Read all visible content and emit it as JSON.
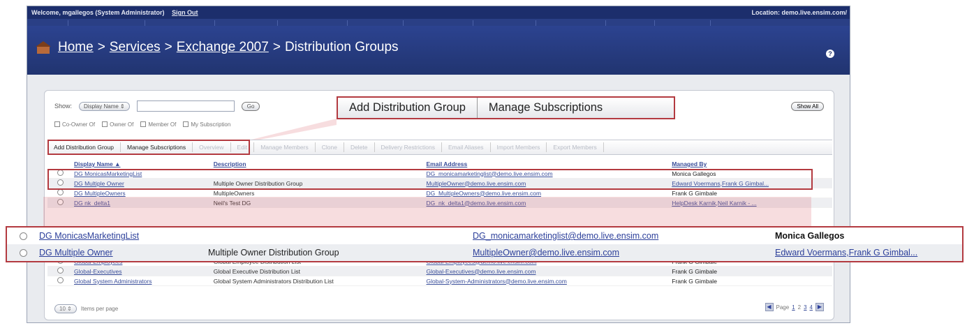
{
  "topbar": {
    "welcome": "Welcome, mgallegos (System Administrator)",
    "signout": "Sign Out",
    "location": "Location: demo.live.ensim.com/"
  },
  "breadcrumb": {
    "home": "Home",
    "services": "Services",
    "exchange": "Exchange 2007",
    "sep": ">",
    "current": "Distribution Groups"
  },
  "filter": {
    "show_label": "Show:",
    "select_value": "Display Name",
    "go_label": "Go",
    "show_all_label": "Show All",
    "checks": [
      "Co-Owner Of",
      "Owner Of",
      "Member Of",
      "My Subscription"
    ]
  },
  "toolbar": {
    "buttons": [
      "Add Distribution Group",
      "Manage Subscriptions",
      "Overview",
      "Edit",
      "Manage Members",
      "Clone",
      "Delete",
      "Delivery Restrictions",
      "Email Aliases",
      "Import Members",
      "Export Members"
    ]
  },
  "table": {
    "headers": [
      "Display Name ▲",
      "Description",
      "Email Address",
      "Managed By"
    ],
    "rows": [
      {
        "name": "DG MonicasMarketingList",
        "desc": "",
        "email": "DG_monicamarketinglist@demo.live.ensim.com",
        "managed": "Monica Gallegos"
      },
      {
        "name": "DG Multiple Owner",
        "desc": "Multiple Owner Distribution Group",
        "email": "MultipleOwner@demo.live.ensim.com",
        "managed": "Edward Voermans,Frank G Gimbal..."
      },
      {
        "name": "DG MultipleOwners",
        "desc": "MultipleOwners",
        "email": "DG_MultipleOwners@demo.live.ensim.com",
        "managed": "Frank G Gimbale"
      },
      {
        "name": "DG nk_delta1",
        "desc": "Neil's Test DG",
        "email": "DG_nk_delta1@demo.live.ensim.com",
        "managed": "HelpDesk Karnik,Neil Karnik - ..."
      },
      {
        "name": "Global-Employees",
        "desc": "Global Employee Distribution List",
        "email": "Global-Employees@demo.live.ensim.com",
        "managed": "Frank G Gimbale"
      },
      {
        "name": "Global-Executives",
        "desc": "Global Executive Distribution List",
        "email": "Global-Executives@demo.live.ensim.com",
        "managed": "Frank G Gimbale"
      },
      {
        "name": "Global System Administrators",
        "desc": "Global System Administrators Distribution List",
        "email": "Global-System-Administrators@demo.live.ensim.com",
        "managed": "Frank G Gimbale"
      }
    ]
  },
  "footer": {
    "per_page_value": "10",
    "per_page_label": "Items per page",
    "page_label": "Page",
    "pages": [
      "1",
      "2",
      "3",
      "4"
    ]
  },
  "colors": {
    "nav_dark": "#1c2e6c",
    "banner": "#2c4390",
    "link": "#3a4e9a",
    "highlight": "#b33a40"
  }
}
